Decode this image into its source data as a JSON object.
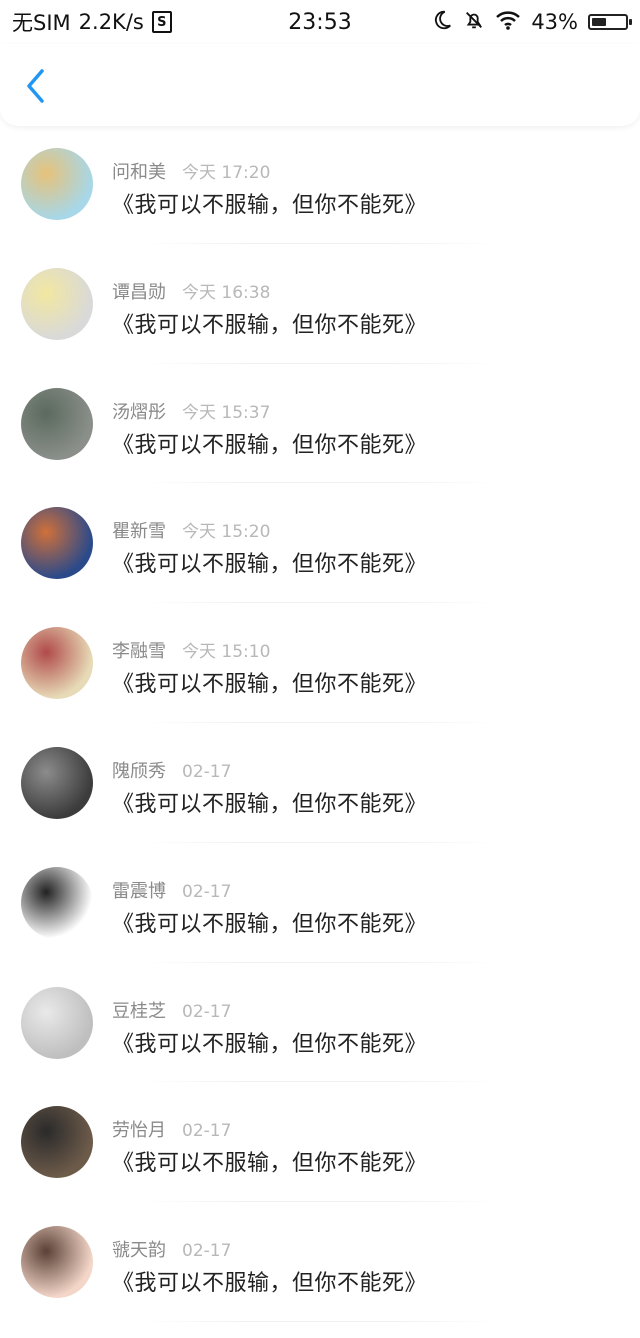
{
  "status_bar": {
    "carrier": "无SIM",
    "speed": "2.2K/s",
    "sim_icon_letter": "S",
    "time": "23:53",
    "battery_percent": "43%",
    "battery_level": 0.43,
    "icons": [
      "moon-icon",
      "bell-off-icon",
      "wifi-icon",
      "battery-icon"
    ]
  },
  "header": {
    "back_icon": "chevron-left-icon",
    "accent_color": "#2196F3"
  },
  "comments": [
    {
      "name": "问和美",
      "time": "今天 17:20",
      "message": "《我可以不服输，但你不能死》",
      "avatar_colors": [
        "#a7d7e8",
        "#e6c27a"
      ]
    },
    {
      "name": "谭昌勋",
      "time": "今天 16:38",
      "message": "《我可以不服输，但你不能死》",
      "avatar_colors": [
        "#d9d9d9",
        "#f2e7a0"
      ]
    },
    {
      "name": "汤熠彤",
      "time": "今天 15:37",
      "message": "《我可以不服输，但你不能死》",
      "avatar_colors": [
        "#8a8f8a",
        "#5b6a5e"
      ]
    },
    {
      "name": "瞿新雪",
      "time": "今天 15:20",
      "message": "《我可以不服输，但你不能死》",
      "avatar_colors": [
        "#2b4a8a",
        "#d0703a"
      ]
    },
    {
      "name": "李融雪",
      "time": "今天 15:10",
      "message": "《我可以不服输，但你不能死》",
      "avatar_colors": [
        "#e7dbb7",
        "#b04a4a"
      ]
    },
    {
      "name": "隗颀秀",
      "time": "02-17",
      "message": "《我可以不服输，但你不能死》",
      "avatar_colors": [
        "#3c3c3c",
        "#8c8c8c"
      ]
    },
    {
      "name": "雷震博",
      "time": "02-17",
      "message": "《我可以不服输，但你不能死》",
      "avatar_colors": [
        "#ffffff",
        "#222222"
      ]
    },
    {
      "name": "豆桂芝",
      "time": "02-17",
      "message": "《我可以不服输，但你不能死》",
      "avatar_colors": [
        "#bfbfbf",
        "#e9e9e9"
      ]
    },
    {
      "name": "劳怡月",
      "time": "02-17",
      "message": "《我可以不服输，但你不能死》",
      "avatar_colors": [
        "#6d5b4a",
        "#2a2a2a"
      ]
    },
    {
      "name": "虢天韵",
      "time": "02-17",
      "message": "《我可以不服输，但你不能死》",
      "avatar_colors": [
        "#f3d6c8",
        "#5a4036"
      ]
    }
  ]
}
